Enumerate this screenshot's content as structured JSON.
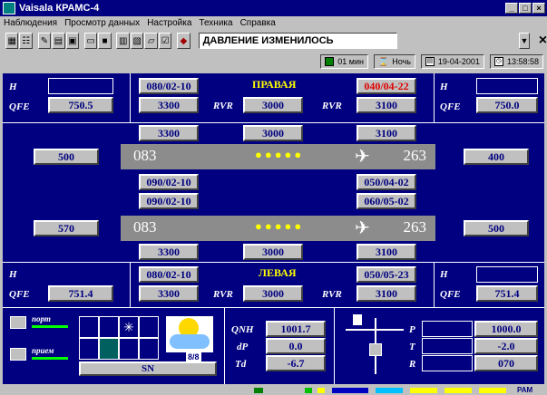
{
  "window": {
    "title": "Vaisala КРАМС-4",
    "buttons": [
      "_",
      "□",
      "×"
    ]
  },
  "menu": [
    "Наблюдения",
    "Просмотр данных",
    "Настройка",
    "Техника",
    "Справка"
  ],
  "toolbar": {
    "message": "ДАВЛЕНИЕ ИЗМЕНИЛОСЬ",
    "dropdown_icon": "chevron-down-icon",
    "close_label": "×"
  },
  "status": {
    "interval": "01 мин",
    "mode": "Ночь",
    "date": "19-04-2001",
    "time": "13:58:58"
  },
  "right_top": {
    "title": "ПРАВАЯ",
    "h_label": "H",
    "qfe_label": "QFE",
    "left_qfe": "750.5",
    "right_qfe": "750.0",
    "wind_left": "080/02-10",
    "wind_right": "040/04-22",
    "rvr_label": "RVR",
    "rvr": [
      "3300",
      "3000",
      "3100"
    ]
  },
  "runway1": {
    "rvr_top": [
      "3300",
      "3000",
      "3100"
    ],
    "heading_left": "083",
    "heading_right": "263",
    "side_left": "500",
    "side_right": "400",
    "lights": "●●●●●"
  },
  "middle": {
    "winds_left": [
      "090/02-10",
      "090/02-10"
    ],
    "winds_right": [
      "050/04-02",
      "060/05-02"
    ]
  },
  "runway2": {
    "heading_left": "083",
    "heading_right": "263",
    "side_left": "570",
    "side_right": "500",
    "rvr_bottom": [
      "3300",
      "3000",
      "3100"
    ],
    "lights": "●●●●●"
  },
  "left_bottom": {
    "title": "ЛЕВАЯ",
    "h_label": "H",
    "qfe_label": "QFE",
    "left_qfe": "751.4",
    "right_qfe": "751.4",
    "wind_left": "080/02-10",
    "wind_right": "050/05-23",
    "rvr_label": "RVR",
    "rvr": [
      "3300",
      "3000",
      "3100"
    ]
  },
  "bottom": {
    "port_label": "порт",
    "recv_label": "прием",
    "cloud": "8/8",
    "sn": "SN",
    "qnh_label": "QNH",
    "qnh": "1001.7",
    "dp_label": "dP",
    "dp": "0.0",
    "td_label": "Td",
    "td": "-6.7",
    "p_label": "P",
    "p": "1000.0",
    "t_label": "T",
    "t": "-2.0",
    "r_label": "R",
    "r": "070"
  },
  "taskbar_label": "PAM"
}
